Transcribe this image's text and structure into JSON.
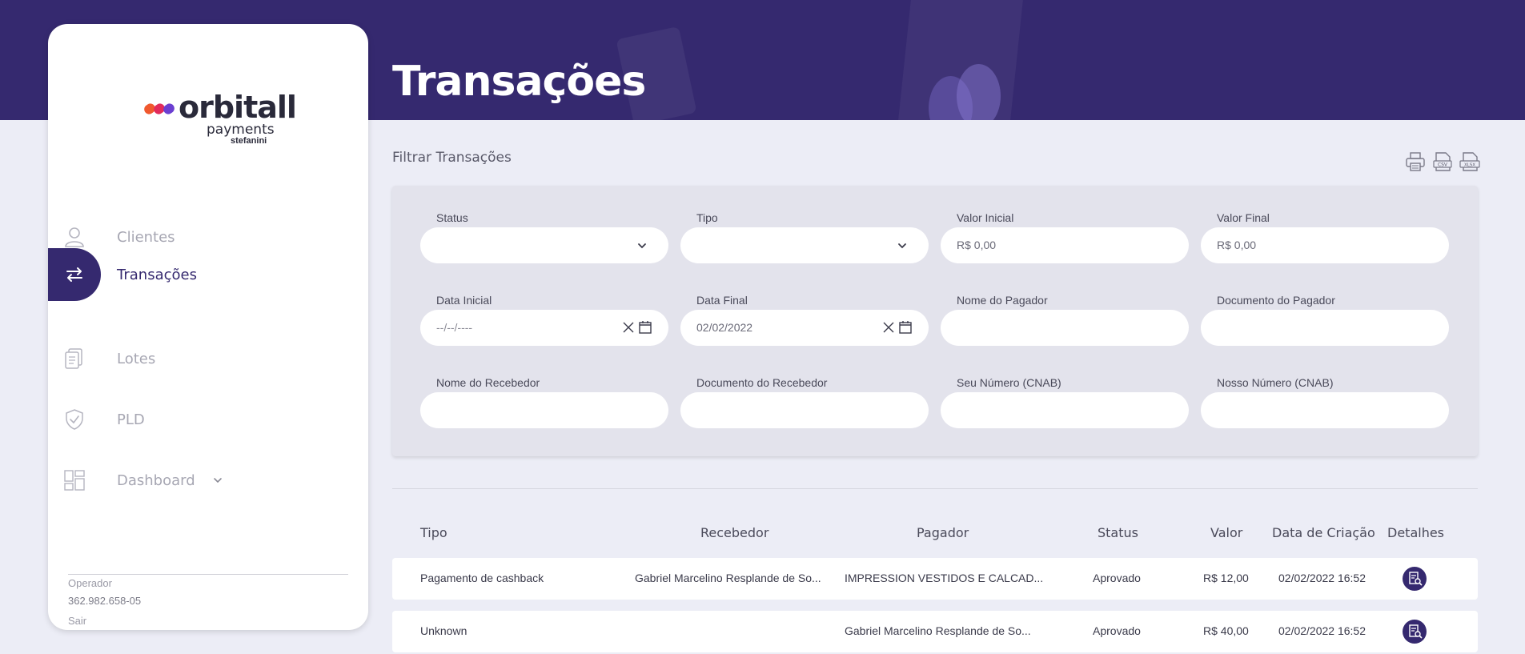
{
  "page": {
    "title": "Transações"
  },
  "brand": {
    "name": "orbitall",
    "sub": "payments",
    "partner": "stefanini",
    "accent": "#35296f",
    "mark_colors": [
      "#f0582e",
      "#e22b5b",
      "#6b3fd1"
    ]
  },
  "sidebar": {
    "items": [
      {
        "label": "Clientes",
        "icon": "user-icon",
        "active": false
      },
      {
        "label": "Transações",
        "icon": "transfer-arrows-icon",
        "active": true
      },
      {
        "label": "Lotes",
        "icon": "documents-icon",
        "active": false
      },
      {
        "label": "PLD",
        "icon": "shield-check-icon",
        "active": false
      },
      {
        "label": "Dashboard",
        "icon": "dashboard-grid-icon",
        "active": false
      }
    ],
    "operator": {
      "label": "Operador",
      "document": "362.982.658-05",
      "logout": "Sair"
    }
  },
  "filters": {
    "title": "Filtrar Transações",
    "export_icons": [
      "print-icon",
      "csv-icon",
      "xlsx-icon"
    ],
    "fields": [
      {
        "label": "Status",
        "value": "",
        "type": "select"
      },
      {
        "label": "Tipo",
        "value": "",
        "type": "select"
      },
      {
        "label": "Valor Inicial",
        "value": "R$ 0,00",
        "type": "text"
      },
      {
        "label": "Valor Final",
        "value": "R$ 0,00",
        "type": "text"
      },
      {
        "label": "Data Inicial",
        "value": "--/--/----",
        "type": "date"
      },
      {
        "label": "Data Final",
        "value": "02/02/2022",
        "type": "date"
      },
      {
        "label": "Nome do Pagador",
        "value": "",
        "type": "text"
      },
      {
        "label": "Documento do Pagador",
        "value": "",
        "type": "text"
      },
      {
        "label": "Nome do Recebedor",
        "value": "",
        "type": "text"
      },
      {
        "label": "Documento do Recebedor",
        "value": "",
        "type": "text"
      },
      {
        "label": "Seu Número (CNAB)",
        "value": "",
        "type": "text"
      },
      {
        "label": "Nosso Número (CNAB)",
        "value": "",
        "type": "text"
      }
    ]
  },
  "table": {
    "headers": [
      "Tipo",
      "Recebedor",
      "Pagador",
      "Status",
      "Valor",
      "Data de Criação",
      "Detalhes"
    ],
    "rows": [
      {
        "tipo": "Pagamento de cashback",
        "recebedor": "Gabriel Marcelino Resplande de So...",
        "pagador": "IMPRESSION VESTIDOS E CALCAD...",
        "status": "Aprovado",
        "valor": "R$ 12,00",
        "data": "02/02/2022 16:52"
      },
      {
        "tipo": "Unknown",
        "recebedor": "",
        "pagador": "Gabriel Marcelino Resplande de So...",
        "status": "Aprovado",
        "valor": "R$ 40,00",
        "data": "02/02/2022 16:52"
      }
    ]
  }
}
